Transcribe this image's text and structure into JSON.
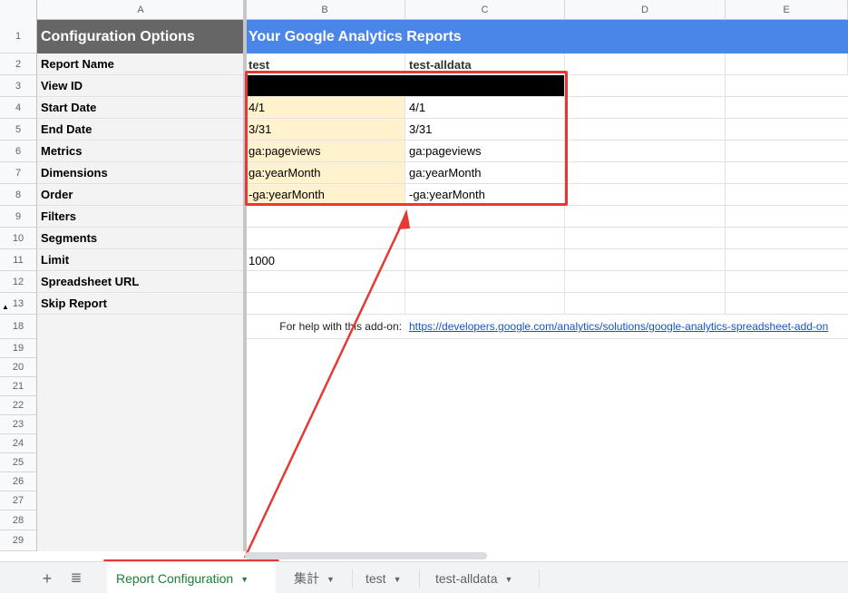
{
  "columns": [
    "A",
    "B",
    "C",
    "D",
    "E"
  ],
  "rows_top": [
    "1",
    "2",
    "3",
    "4",
    "5",
    "6",
    "7",
    "8",
    "9",
    "10",
    "11",
    "12",
    "13"
  ],
  "rows_bottom": [
    "18",
    "19",
    "20",
    "21",
    "22",
    "23",
    "24",
    "25",
    "26",
    "27",
    "28",
    "29"
  ],
  "sheet": {
    "config_header": "Configuration Options",
    "reports_header": "Your Google Analytics Reports",
    "labels": [
      "Report Name",
      "View ID",
      "Start Date",
      "End Date",
      "Metrics",
      "Dimensions",
      "Order",
      "Filters",
      "Segments",
      "Limit",
      "Spreadsheet URL",
      "Skip Report"
    ],
    "report_b": {
      "name": "test",
      "start": "4/1",
      "end": "3/31",
      "metrics": "ga:pageviews",
      "dimensions": "ga:yearMonth",
      "order": "-ga:yearMonth",
      "limit": "1000"
    },
    "report_c": {
      "name": "test-alldata",
      "start": "4/1",
      "end": "3/31",
      "metrics": "ga:pageviews",
      "dimensions": "ga:yearMonth",
      "order": "-ga:yearMonth"
    },
    "help_text": "For help with this add-on:",
    "help_link": "https://developers.google.com/analytics/solutions/google-analytics-spreadsheet-add-on"
  },
  "tabs": {
    "add_icon": "plus-icon",
    "list_icon": "list-icon",
    "items": [
      "Report Configuration",
      "集計",
      "test",
      "test-alldata"
    ],
    "active": "Report Configuration"
  },
  "colors": {
    "accent_red": "#e53935",
    "header_blue": "#4a86e8",
    "header_gray": "#666666",
    "highlight": "#fff2cc",
    "active_tab": "#188038"
  }
}
